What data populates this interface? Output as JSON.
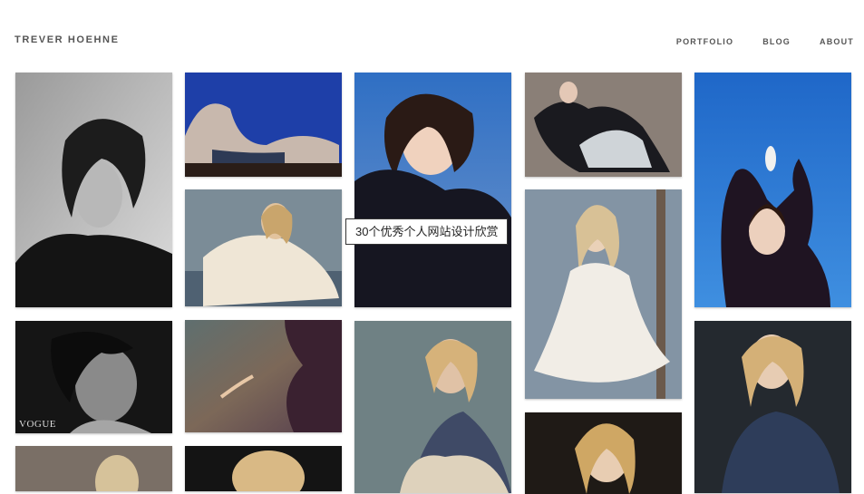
{
  "header": {
    "brand": "TREVER HOEHNE",
    "nav": [
      "PORTFOLIO",
      "BLOG",
      "ABOUT"
    ]
  },
  "photos": {
    "watermark": "VOGUE"
  },
  "tooltip": "30个优秀个人网站设计欣赏"
}
